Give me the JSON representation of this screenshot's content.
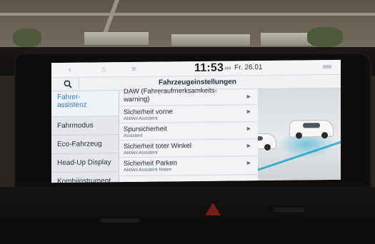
{
  "topbar": {
    "back_icon": "chevron-left-icon",
    "home_icon": "home-icon",
    "menu_icon": "menu-icon",
    "time": "11:53",
    "ampm": "AM",
    "date": "Fr. 26.01"
  },
  "header": {
    "search_icon": "search-icon",
    "title": "Fahrzeugeinstellungen"
  },
  "sidebar": {
    "items": [
      {
        "label": "Fahrer-\nassistenz",
        "active": true
      },
      {
        "label": "Fahrmodus"
      },
      {
        "label": "Eco-Fahrzeug"
      },
      {
        "label": "Head-Up Display"
      },
      {
        "label": "Kombiinstrument"
      }
    ]
  },
  "settings": {
    "rows": [
      {
        "title": "DAW (Fahreraufmerksamkeits-",
        "title2": "warning)",
        "subtitle": ""
      },
      {
        "title": "Sicherheit vorne",
        "subtitle": "Aktiver Assistent"
      },
      {
        "title": "Spursicherheit",
        "subtitle": "Assistent"
      },
      {
        "title": "Sicherheit toter Winkel",
        "subtitle": "Aktiver Assistent"
      },
      {
        "title": "Sicherheit Parken",
        "subtitle": "Aktiver Assistent hinten"
      }
    ]
  },
  "colors": {
    "accent": "#2d7fd8",
    "screen_bg": "#e9ebee",
    "lane_highlight": "#1fa8c9"
  }
}
